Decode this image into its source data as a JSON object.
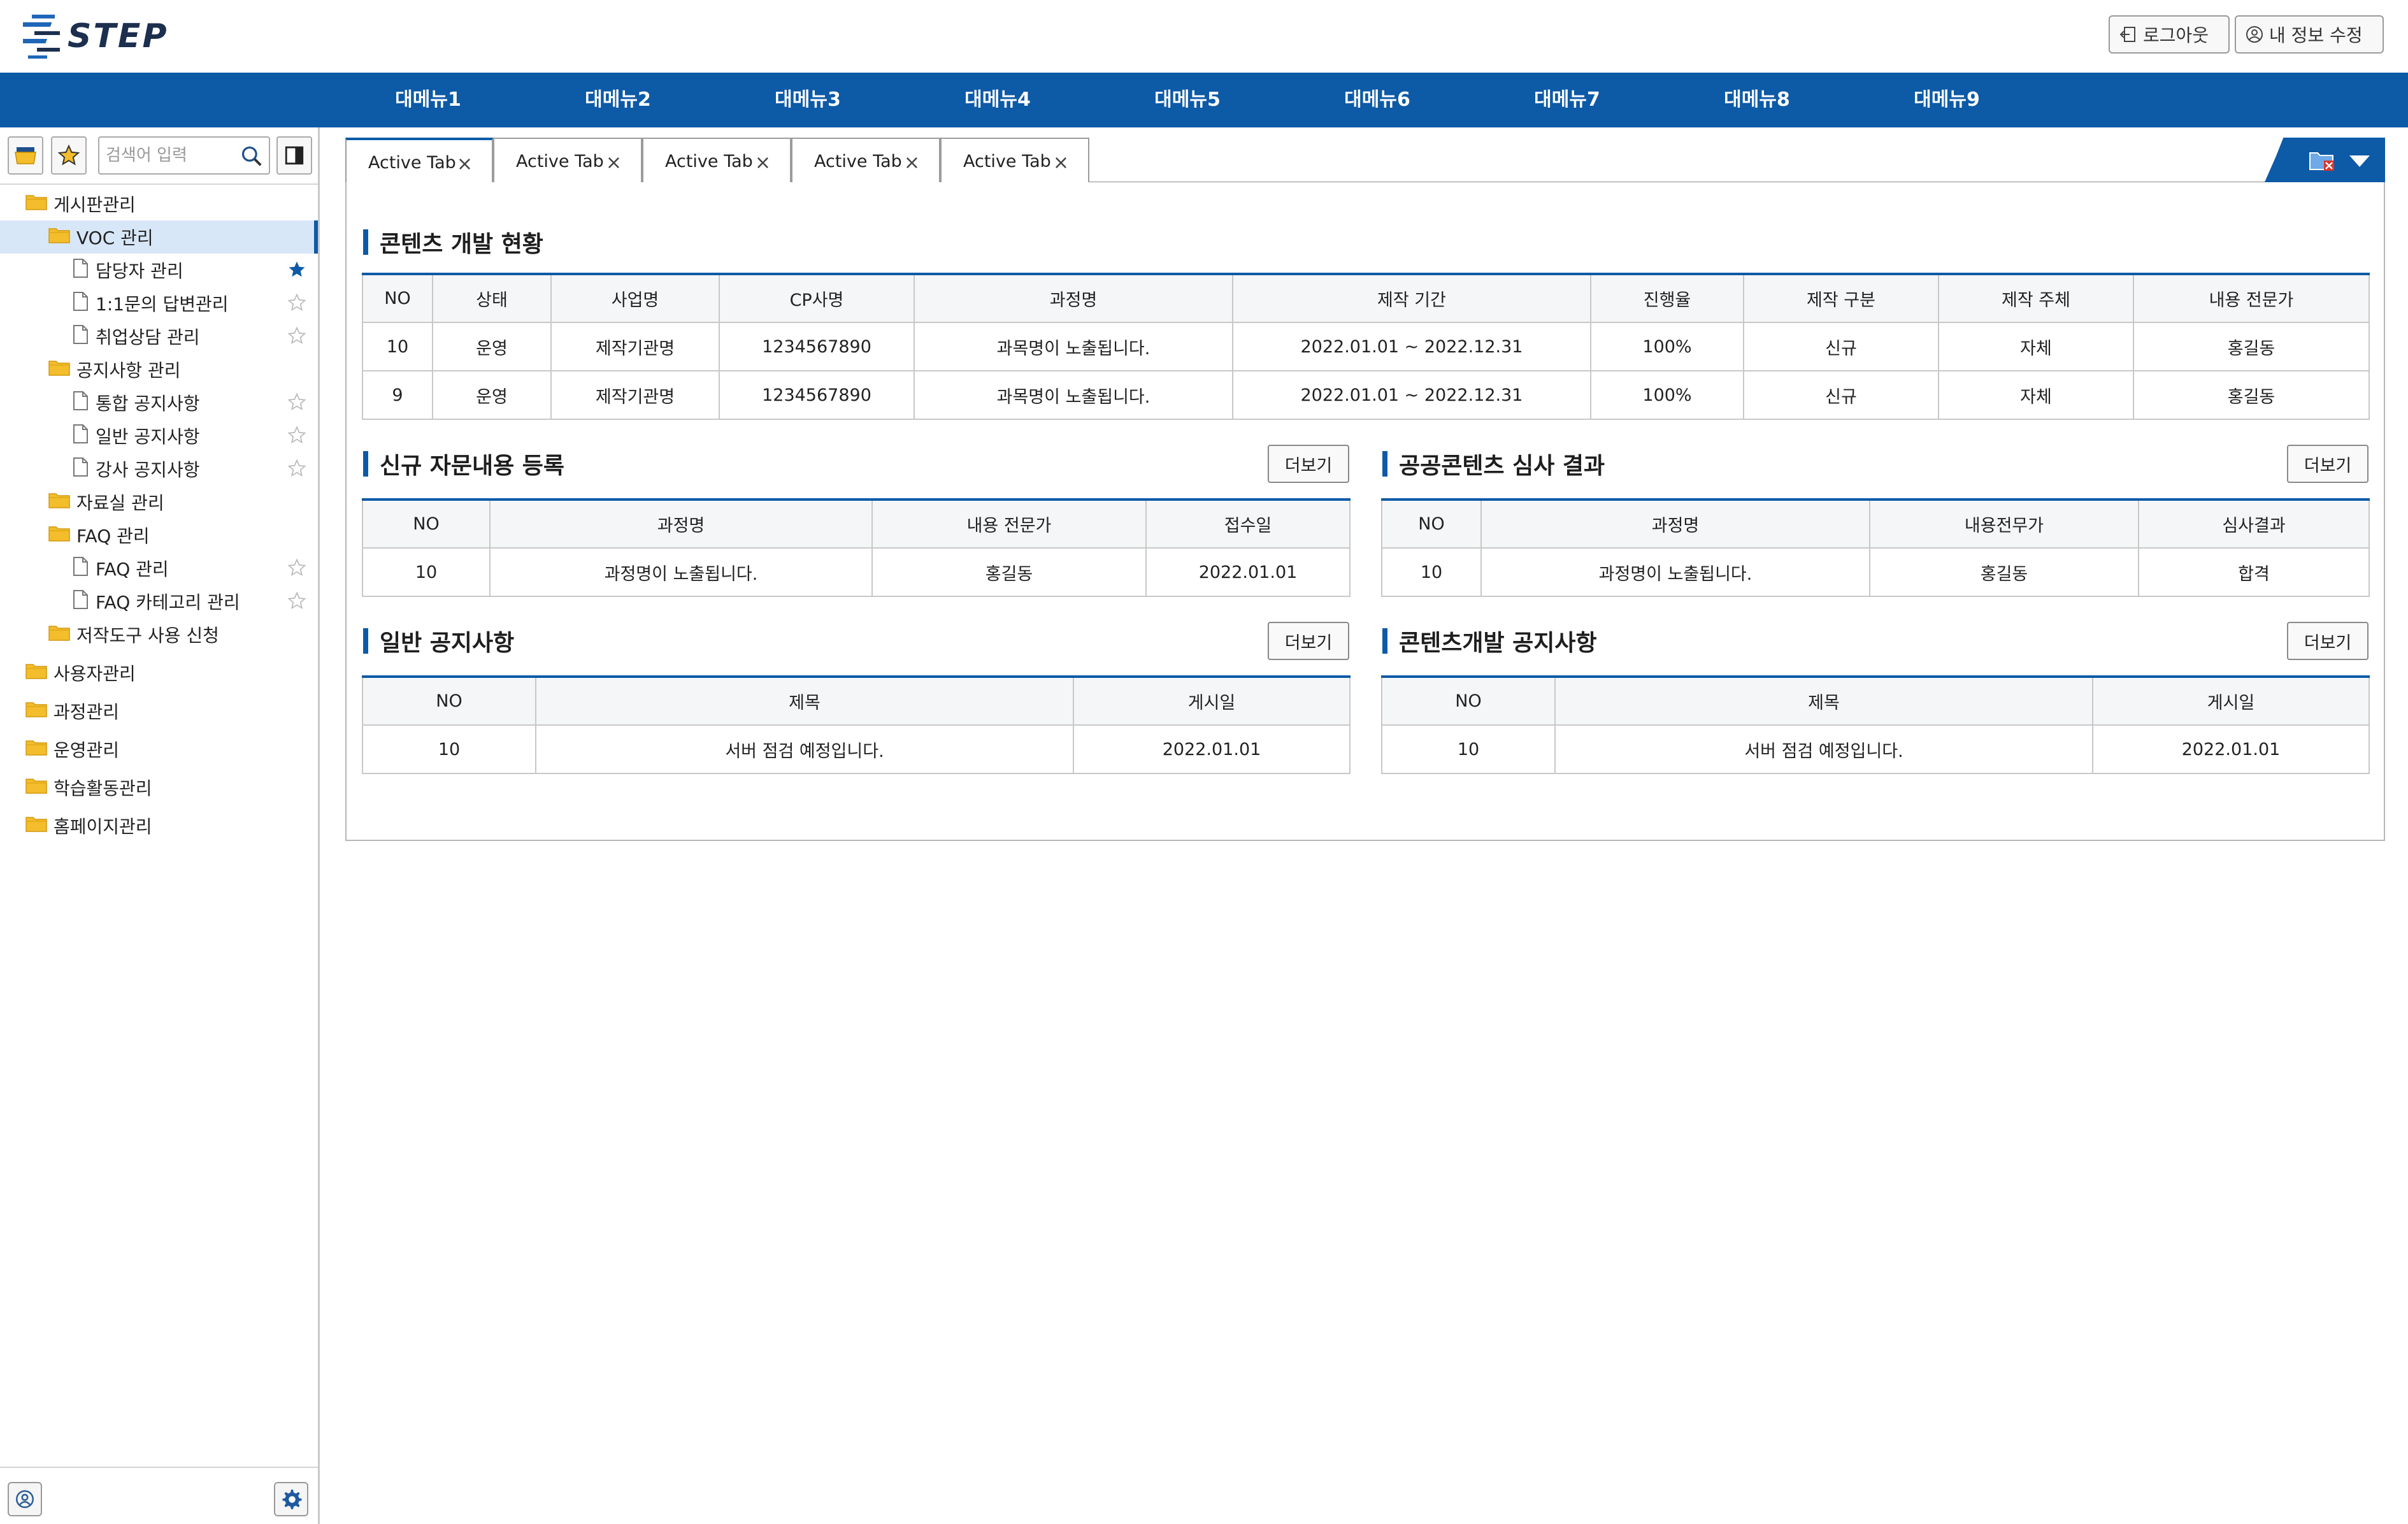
{
  "header": {
    "logo_text": "STEP",
    "logout_label": "로그아웃",
    "myinfo_label": "내 정보 수정"
  },
  "topnav": [
    "대메뉴1",
    "대메뉴2",
    "대메뉴3",
    "대메뉴4",
    "대메뉴5",
    "대메뉴6",
    "대메뉴7",
    "대메뉴8",
    "대메뉴9"
  ],
  "sidebar": {
    "search_placeholder": "검색어 입력",
    "tree": [
      {
        "label": "게시판관리",
        "level": 0,
        "type": "folder"
      },
      {
        "label": "VOC 관리",
        "level": 1,
        "type": "folder",
        "selected": true
      },
      {
        "label": "담당자 관리",
        "level": 2,
        "type": "page",
        "star": "filled"
      },
      {
        "label": "1:1문의 답변관리",
        "level": 2,
        "type": "page",
        "star": "empty"
      },
      {
        "label": "취업상담 관리",
        "level": 2,
        "type": "page",
        "star": "empty"
      },
      {
        "label": "공지사항 관리",
        "level": 1,
        "type": "folder"
      },
      {
        "label": "통합 공지사항",
        "level": 2,
        "type": "page",
        "star": "empty"
      },
      {
        "label": "일반 공지사항",
        "level": 2,
        "type": "page",
        "star": "empty"
      },
      {
        "label": "강사 공지사항",
        "level": 2,
        "type": "page",
        "star": "empty"
      },
      {
        "label": "자료실 관리",
        "level": 1,
        "type": "folder"
      },
      {
        "label": "FAQ 관리",
        "level": 1,
        "type": "folder"
      },
      {
        "label": "FAQ 관리",
        "level": 2,
        "type": "page",
        "star": "empty"
      },
      {
        "label": "FAQ 카테고리 관리",
        "level": 2,
        "type": "page",
        "star": "empty"
      },
      {
        "label": "저작도구 사용 신청",
        "level": 1,
        "type": "folder"
      },
      {
        "label": "사용자관리",
        "level": 0,
        "type": "folder"
      },
      {
        "label": "과정관리",
        "level": 0,
        "type": "folder"
      },
      {
        "label": "운영관리",
        "level": 0,
        "type": "folder"
      },
      {
        "label": "학습활동관리",
        "level": 0,
        "type": "folder"
      },
      {
        "label": "홈페이지관리",
        "level": 0,
        "type": "folder"
      }
    ]
  },
  "tabs": [
    "Active Tab",
    "Active Tab",
    "Active Tab",
    "Active Tab",
    "Active Tab"
  ],
  "colors": {
    "brand": "#0d5aa7",
    "star_filled": "#0d5aa7",
    "folder": "#f3bd2b"
  },
  "sections": {
    "dev_status": {
      "title": "콘텐츠 개발 현황",
      "headers": [
        "NO",
        "상태",
        "사업명",
        "CP사명",
        "과정명",
        "제작 기간",
        "진행율",
        "제작 구분",
        "제작 주체",
        "내용 전문가"
      ],
      "rows": [
        [
          "10",
          "운영",
          "제작기관명",
          "1234567890",
          "과목명이 노출됩니다.",
          "2022.01.01 ~ 2022.12.31",
          "100%",
          "신규",
          "자체",
          "홍길동"
        ],
        [
          "9",
          "운영",
          "제작기관명",
          "1234567890",
          "과목명이 노출됩니다.",
          "2022.01.01 ~ 2022.12.31",
          "100%",
          "신규",
          "자체",
          "홍길동"
        ]
      ]
    },
    "advisory": {
      "title": "신규 자문내용 등록",
      "more": "더보기",
      "headers": [
        "NO",
        "과정명",
        "내용 전문가",
        "접수일"
      ],
      "rows": [
        [
          "10",
          "과정명이 노출됩니다.",
          "홍길동",
          "2022.01.01"
        ]
      ]
    },
    "review": {
      "title": "공공콘텐츠 심사 결과",
      "more": "더보기",
      "headers": [
        "NO",
        "과정명",
        "내용전무가",
        "심사결과"
      ],
      "rows": [
        [
          "10",
          "과정명이 노출됩니다.",
          "홍길동",
          "합격"
        ]
      ]
    },
    "general_notice": {
      "title": "일반 공지사항",
      "more": "더보기",
      "headers": [
        "NO",
        "제목",
        "게시일"
      ],
      "rows": [
        [
          "10",
          "서버 점검 예정입니다.",
          "2022.01.01"
        ]
      ]
    },
    "content_notice": {
      "title": "콘텐츠개발 공지사항",
      "more": "더보기",
      "headers": [
        "NO",
        "제목",
        "게시일"
      ],
      "rows": [
        [
          "10",
          "서버 점검 예정입니다.",
          "2022.01.01"
        ]
      ]
    }
  }
}
